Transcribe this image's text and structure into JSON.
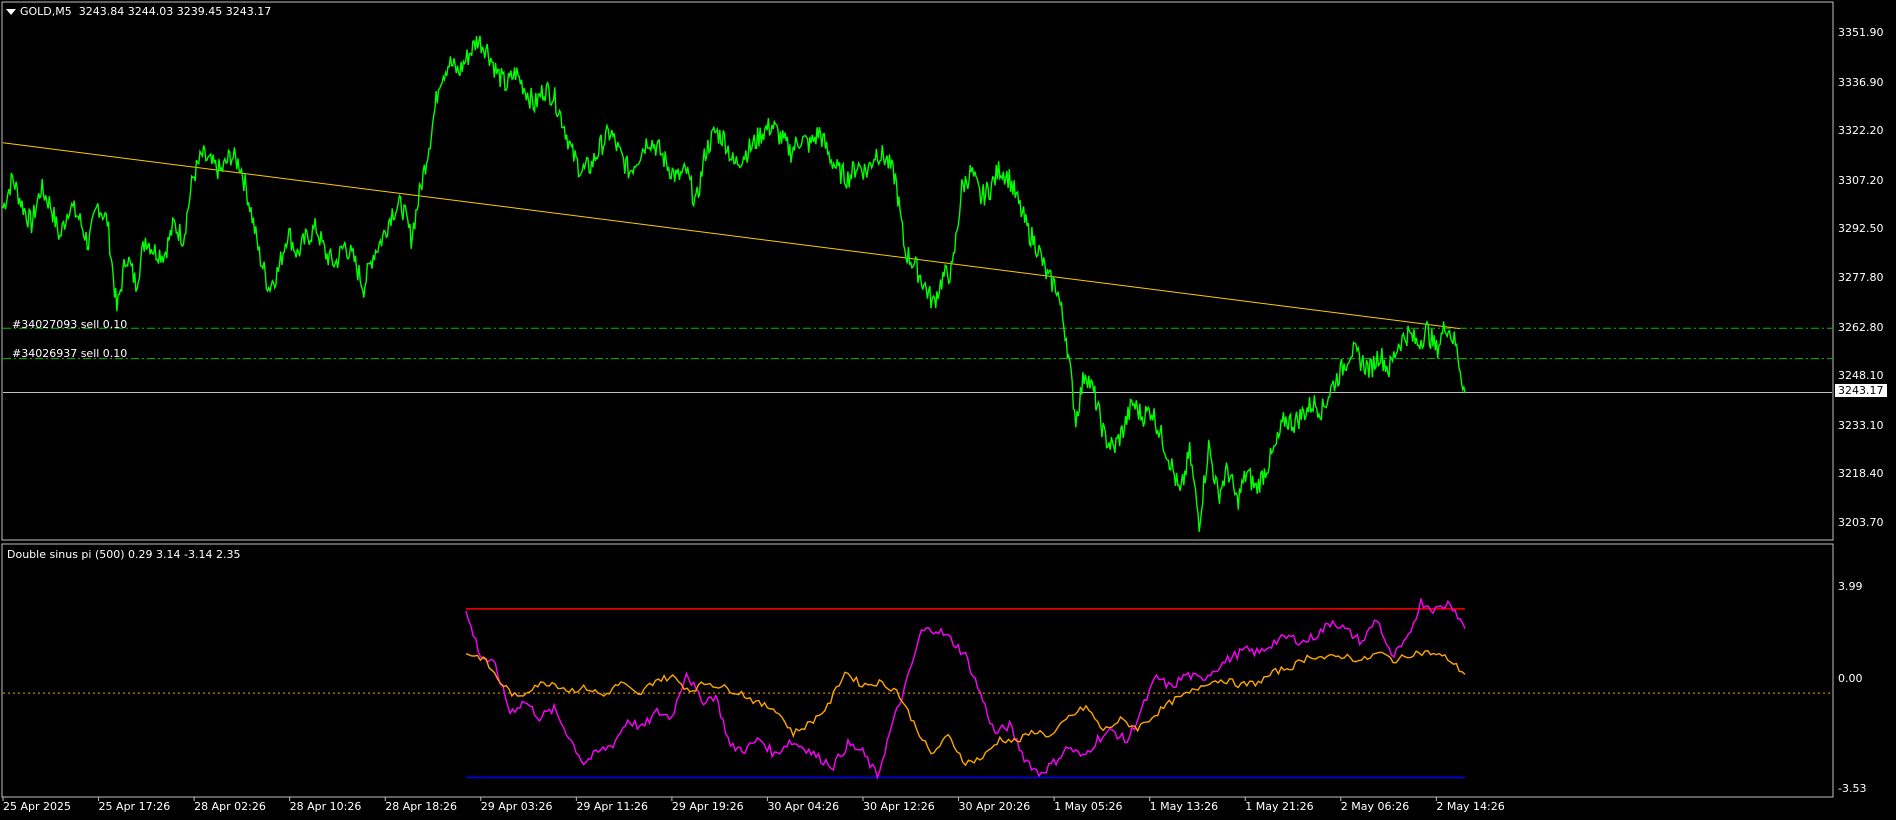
{
  "main": {
    "symbol": "GOLD,M5",
    "ohlc": "3243.84 3244.03 3239.45 3243.17",
    "current_price": "3243.17",
    "price_axis": [
      "3351.90",
      "3336.90",
      "3322.20",
      "3307.20",
      "3292.50",
      "3277.80",
      "3262.80",
      "3248.10",
      "3233.10",
      "3218.40",
      "3203.70"
    ],
    "orders": [
      {
        "label": "#34027093 sell 0.10",
        "price": 3262.6
      },
      {
        "label": "#34026937 sell 0.10",
        "price": 3253.4
      }
    ],
    "trendline": {
      "from_price": 3318.7,
      "to_price": 3262.5
    },
    "series_color": "#00ff00",
    "trendline_color": "#ffcc00",
    "order_line_color": "#00c000",
    "price_points": [
      3299,
      3308,
      3300,
      3294,
      3305,
      3300,
      3290,
      3300,
      3296,
      3288,
      3300,
      3295,
      3268,
      3285,
      3276,
      3290,
      3286,
      3285,
      3294,
      3290,
      3308,
      3315,
      3312,
      3310,
      3315,
      3312,
      3300,
      3285,
      3275,
      3280,
      3292,
      3285,
      3290,
      3293,
      3285,
      3282,
      3288,
      3283,
      3275,
      3285,
      3290,
      3298,
      3300,
      3290,
      3305,
      3320,
      3338,
      3343,
      3340,
      3345,
      3350,
      3347,
      3340,
      3336,
      3340,
      3335,
      3330,
      3335,
      3333,
      3325,
      3315,
      3310,
      3312,
      3318,
      3322,
      3315,
      3310,
      3315,
      3320,
      3317,
      3312,
      3308,
      3310,
      3300,
      3316,
      3322,
      3320,
      3312,
      3315,
      3318,
      3322,
      3324,
      3320,
      3316,
      3320,
      3318,
      3322,
      3315,
      3310,
      3308,
      3312,
      3310,
      3316,
      3314,
      3308,
      3286,
      3282,
      3276,
      3270,
      3278,
      3280,
      3305,
      3310,
      3302,
      3305,
      3311,
      3308,
      3300,
      3292,
      3287,
      3278,
      3275,
      3260,
      3235,
      3250,
      3242,
      3230,
      3226,
      3232,
      3240,
      3236,
      3238,
      3230,
      3222,
      3212,
      3225,
      3204,
      3227,
      3212,
      3220,
      3210,
      3219,
      3214,
      3220,
      3226,
      3235,
      3234,
      3237,
      3240,
      3238,
      3245,
      3250,
      3256,
      3253,
      3250,
      3255,
      3250,
      3258,
      3261,
      3258,
      3262,
      3256,
      3264,
      3258,
      3243
    ]
  },
  "time_axis": [
    "25 Apr 2025",
    "25 Apr 17:26",
    "28 Apr 02:26",
    "28 Apr 10:26",
    "28 Apr 18:26",
    "29 Apr 03:26",
    "29 Apr 11:26",
    "29 Apr 19:26",
    "30 Apr 04:26",
    "30 Apr 12:26",
    "30 Apr 20:26",
    "1 May 05:26",
    "1 May 13:26",
    "1 May 21:26",
    "2 May 06:26",
    "2 May 14:26"
  ],
  "indicator": {
    "title": "Double sinus pi (500) 0.29 3.14 -3.14 2.35",
    "axis": [
      "3.99",
      "0.00",
      "-3.53"
    ],
    "upper_level": 3.14,
    "lower_level": -3.14,
    "zero_level": 0.0,
    "upper_color": "#ff0000",
    "lower_color": "#0000ff",
    "zero_color": "#ffa500",
    "magenta_color": "#ff00ff",
    "orange_color": "#ffa500",
    "magenta_values": [
      3.0,
      1.4,
      1.0,
      -0.7,
      -0.3,
      -0.9,
      -0.6,
      -1.6,
      -2.6,
      -2.2,
      -1.9,
      -1.0,
      -1.3,
      -0.7,
      -0.9,
      0.8,
      -0.3,
      -0.1,
      -2.0,
      -2.1,
      -1.7,
      -2.3,
      -1.8,
      -2.0,
      -2.4,
      -2.7,
      -1.9,
      -2.2,
      -3.1,
      -1.2,
      0.4,
      2.3,
      2.4,
      2.0,
      1.4,
      0.0,
      -1.5,
      -1.2,
      -2.4,
      -3.0,
      -2.6,
      -2.0,
      -2.4,
      -1.7,
      -1.4,
      -1.8,
      -0.6,
      0.6,
      0.2,
      0.7,
      0.5,
      0.9,
      1.3,
      1.6,
      1.5,
      1.9,
      2.1,
      1.9,
      2.2,
      2.7,
      2.3,
      1.9,
      2.8,
      1.3,
      1.9,
      3.4,
      3.1,
      3.4,
      2.4
    ],
    "orange_values": [
      1.5,
      1.3,
      0.4,
      -0.2,
      0.3,
      0.4,
      0.1,
      0.2,
      -0.1,
      0.4,
      -0.1,
      0.5,
      0.6,
      0.1,
      0.4,
      0.2,
      0.0,
      -0.4,
      -0.6,
      -1.5,
      -1.1,
      -0.5,
      0.8,
      0.3,
      0.4,
      0.1,
      -1.1,
      -2.3,
      -1.6,
      -2.6,
      -2.4,
      -1.7,
      -1.8,
      -1.4,
      -1.6,
      -0.9,
      -0.5,
      -1.4,
      -1.0,
      -1.3,
      -0.8,
      -0.3,
      0.0,
      0.4,
      0.5,
      0.3,
      0.4,
      0.8,
      1.0,
      1.4,
      1.3,
      1.4,
      1.2,
      1.5,
      1.2,
      1.5,
      1.5,
      1.3,
      0.7
    ]
  }
}
